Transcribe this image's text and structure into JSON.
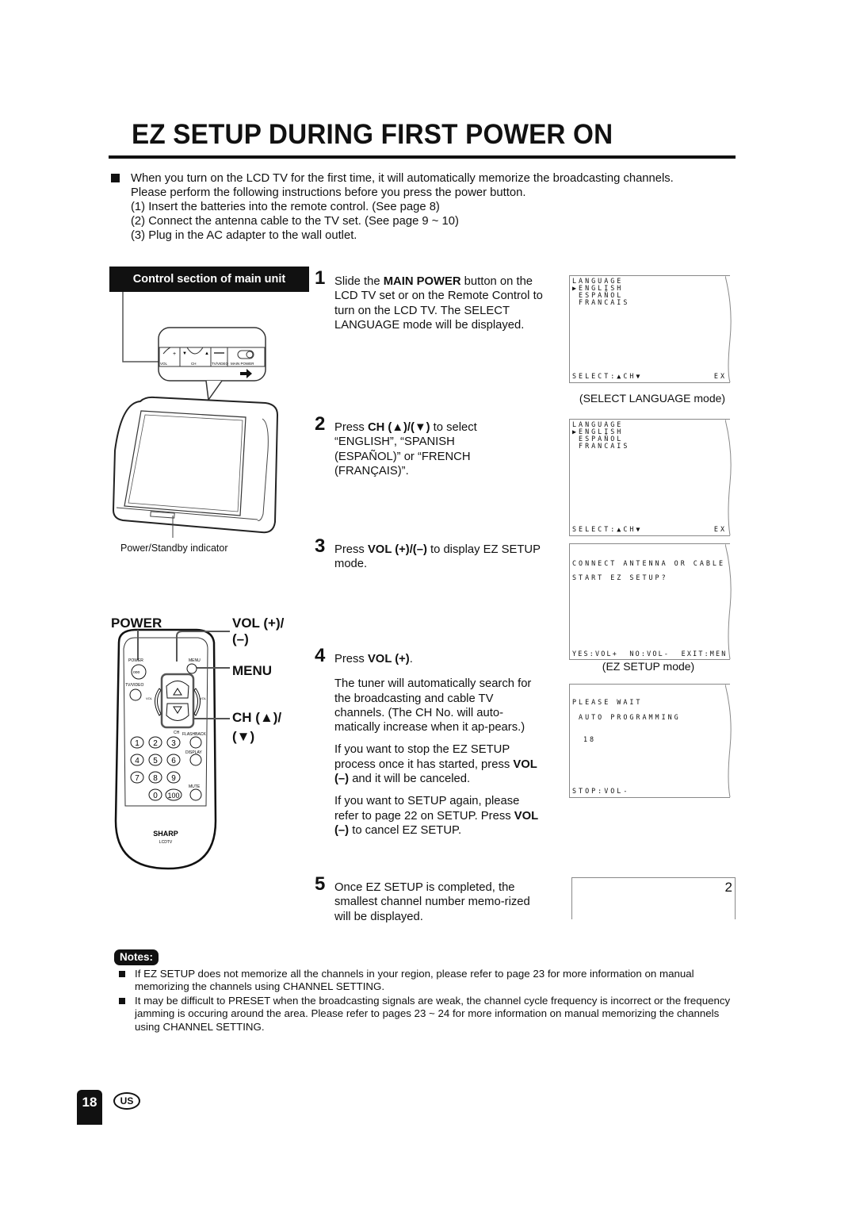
{
  "page": {
    "title": "EZ SETUP DURING FIRST POWER ON",
    "page_number": "18",
    "region_badge": "US"
  },
  "intro": {
    "lead": "When you turn on the LCD TV for the first time, it will automatically memorize the broadcasting channels.",
    "instruction": "Please perform the following instructions before you press the power button.",
    "items": [
      "(1) Insert the batteries into the remote control. (See page 8)",
      "(2) Connect the antenna cable to the TV set.  (See page 9 ~ 10)",
      "(3) Plug in the AC adapter to the wall outlet."
    ]
  },
  "illustration": {
    "control_section_label": "Control section of main unit",
    "panel_labels": {
      "vol": "VOL",
      "ch": "CH",
      "tv_video": "TV/VIDEO",
      "main_power": "MAIN POWER"
    },
    "power_indicator_label": "Power/Standby indicator",
    "remote": {
      "callouts": {
        "power": "POWER",
        "vol": "VOL (+)/",
        "vol2": "(–)",
        "menu": "MENU",
        "ch": "CH (▲)/",
        "ch2": "(▼)"
      },
      "button_labels": {
        "power": "POWER",
        "menu": "MENU",
        "tv_video": "TV/VIDEO",
        "vol_minus": "VOL –",
        "vol_plus": "VOL +",
        "ch": "CH",
        "flashback": "FLASHBACK",
        "display": "DISPLAY",
        "mute": "MUTE"
      },
      "digits": [
        "1",
        "2",
        "3",
        "4",
        "5",
        "6",
        "7",
        "8",
        "9",
        "0",
        "100"
      ],
      "brand": "SHARP",
      "model": "LCDTV"
    }
  },
  "steps": [
    {
      "num": "1",
      "paragraphs": [
        {
          "pre": "Slide the ",
          "bold": "MAIN POWER",
          "post": " button on the LCD TV set or on the Remote Control to turn on the LCD TV. The SELECT LANGUAGE mode will be displayed."
        }
      ]
    },
    {
      "num": "2",
      "paragraphs": [
        {
          "pre": "Press ",
          "bold": "CH (▲)/(▼)",
          "post": " to select “ENGLISH”, “SPANISH (ESPAÑOL)” or “FRENCH (FRANÇAIS)”."
        }
      ]
    },
    {
      "num": "3",
      "paragraphs": [
        {
          "pre": "Press ",
          "bold": "VOL (+)/(–)",
          "post": " to display EZ SETUP mode."
        }
      ]
    },
    {
      "num": "4",
      "paragraphs": [
        {
          "pre": "Press ",
          "bold": "VOL (+)",
          "post": "."
        },
        {
          "pre": "The tuner will automatically search for the broadcasting and cable TV channels. (The CH No. will auto-matically increase when it ap-pears.)",
          "bold": "",
          "post": ""
        },
        {
          "pre": "If you want to stop the EZ SETUP process once it has started, press ",
          "bold": "VOL (–)",
          "post": " and it will be canceled."
        },
        {
          "pre": "If you want to SETUP again, please refer to page 22 on SETUP. Press ",
          "bold": "VOL (–)",
          "post": " to cancel EZ SETUP."
        }
      ]
    },
    {
      "num": "5",
      "paragraphs": [
        {
          "pre": "Once EZ SETUP is completed, the smallest channel number memo-rized will be displayed.",
          "bold": "",
          "post": ""
        }
      ]
    }
  ],
  "screens": {
    "lang1": {
      "lines": [
        "LANGUAGE",
        "▶ENGLISH",
        " ESPAÑOL",
        " FRANCAIS"
      ],
      "footer_left": "SELECT:▲CH▼",
      "footer_right": "EX",
      "caption": "(SELECT LANGUAGE mode)"
    },
    "lang2": {
      "lines": [
        "LANGUAGE",
        "▶ENGLISH",
        " ESPAÑOL",
        " FRANCAIS"
      ],
      "footer_left": "SELECT:▲CH▼",
      "footer_right": "EX"
    },
    "ez": {
      "line1": "CONNECT ANTENNA OR CABLE",
      "line2": "START EZ SETUP?",
      "footer": "YES:VOL+  NO:VOL-  EXIT:MEN",
      "caption": "(EZ SETUP mode)"
    },
    "auto": {
      "line1": "PLEASE WAIT",
      "line2": " AUTO PROGRAMMING",
      "channel": "18",
      "footer": "STOP:VOL-"
    },
    "done": {
      "channel": "2"
    }
  },
  "notes": {
    "badge": "Notes:",
    "items": [
      "If EZ SETUP does not memorize all the channels in your region, please refer to page 23 for more information on manual memorizing the channels using CHANNEL SETTING.",
      "It may be difficult to PRESET when the broadcasting signals are weak, the channel cycle frequency is incorrect or the frequency jamming is occuring around the area. Please refer to pages 23 ~ 24 for more information on manual memorizing the channels using CHANNEL SETTING."
    ]
  }
}
